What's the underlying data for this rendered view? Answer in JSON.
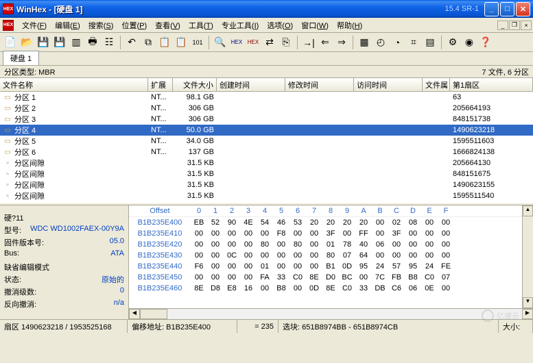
{
  "window": {
    "title": "WinHex - [硬盘 1]",
    "version": "15.4 SR-1"
  },
  "menus": [
    {
      "label": "文件",
      "hot": "F"
    },
    {
      "label": "编辑",
      "hot": "E"
    },
    {
      "label": "搜索",
      "hot": "S"
    },
    {
      "label": "位置",
      "hot": "P"
    },
    {
      "label": "查看",
      "hot": "V"
    },
    {
      "label": "工具",
      "hot": "T"
    },
    {
      "label": "专业工具",
      "hot": "I"
    },
    {
      "label": "选项",
      "hot": "O"
    },
    {
      "label": "窗口",
      "hot": "W"
    },
    {
      "label": "帮助",
      "hot": "H"
    }
  ],
  "tab": "硬盘 1",
  "info_left": "分区类型: MBR",
  "info_right": "7 文件, 6 分区",
  "columns": {
    "name": "文件名称",
    "ext": "扩展",
    "size": "文件大小",
    "ctime": "创建时间",
    "mtime": "修改时间",
    "atime": "访问时间",
    "attr": "文件属",
    "sect": "第1扇区"
  },
  "files": [
    {
      "icon": "part",
      "name": "分区 1",
      "ext": "NT...",
      "size": "98.1 GB",
      "sect": "63"
    },
    {
      "icon": "part",
      "name": "分区 2",
      "ext": "NT...",
      "size": "306 GB",
      "sect": "205664193"
    },
    {
      "icon": "part",
      "name": "分区 3",
      "ext": "NT...",
      "size": "306 GB",
      "sect": "848151738"
    },
    {
      "icon": "part",
      "name": "分区 4",
      "ext": "NT...",
      "size": "50.0 GB",
      "sect": "1490623218",
      "sel": true
    },
    {
      "icon": "part",
      "name": "分区 5",
      "ext": "NT...",
      "size": "34.0 GB",
      "sect": "1595511603"
    },
    {
      "icon": "part",
      "name": "分区 6",
      "ext": "NT...",
      "size": "137 GB",
      "sect": "1666824138"
    },
    {
      "icon": "gap",
      "name": "分区间隙",
      "ext": "",
      "size": "31.5 KB",
      "sect": "205664130"
    },
    {
      "icon": "gap",
      "name": "分区间隙",
      "ext": "",
      "size": "31.5 KB",
      "sect": "848151675"
    },
    {
      "icon": "gap",
      "name": "分区间隙",
      "ext": "",
      "size": "31.5 KB",
      "sect": "1490623155"
    },
    {
      "icon": "gap",
      "name": "分区间隙",
      "ext": "",
      "size": "31.5 KB",
      "sect": "1595511540"
    }
  ],
  "panel": {
    "title": "硬?11",
    "model_lbl": "型号:",
    "model": "WDC WD1002FAEX-00Y9A",
    "fw_lbl": "固件版本号:",
    "fw": "05.0",
    "bus_lbl": "Bus:",
    "bus": "ATA",
    "editmode": "缺省编辑模式",
    "state_lbl": "状态:",
    "state": "原始的",
    "undo_lbl": "撤消级数:",
    "undo": "0",
    "rev_lbl": "反向撤消:",
    "rev": "n/a"
  },
  "hex": {
    "offset_lbl": "Offset",
    "cols": [
      "0",
      "1",
      "2",
      "3",
      "4",
      "5",
      "6",
      "7",
      "8",
      "9",
      "A",
      "B",
      "C",
      "D",
      "E",
      "F"
    ],
    "rows": [
      {
        "o": "B1B235E400",
        "b": [
          "EB",
          "52",
          "90",
          "4E",
          "54",
          "46",
          "53",
          "20",
          "20",
          "20",
          "20",
          "00",
          "02",
          "08",
          "00",
          "00"
        ]
      },
      {
        "o": "B1B235E410",
        "b": [
          "00",
          "00",
          "00",
          "00",
          "00",
          "F8",
          "00",
          "00",
          "3F",
          "00",
          "FF",
          "00",
          "3F",
          "00",
          "00",
          "00"
        ]
      },
      {
        "o": "B1B235E420",
        "b": [
          "00",
          "00",
          "00",
          "00",
          "80",
          "00",
          "80",
          "00",
          "01",
          "78",
          "40",
          "06",
          "00",
          "00",
          "00",
          "00"
        ]
      },
      {
        "o": "B1B235E430",
        "b": [
          "00",
          "00",
          "0C",
          "00",
          "00",
          "00",
          "00",
          "00",
          "80",
          "07",
          "64",
          "00",
          "00",
          "00",
          "00",
          "00"
        ]
      },
      {
        "o": "B1B235E440",
        "b": [
          "F6",
          "00",
          "00",
          "00",
          "01",
          "00",
          "00",
          "00",
          "B1",
          "0D",
          "95",
          "24",
          "57",
          "95",
          "24",
          "FE"
        ]
      },
      {
        "o": "B1B235E450",
        "b": [
          "00",
          "00",
          "00",
          "00",
          "FA",
          "33",
          "C0",
          "8E",
          "D0",
          "BC",
          "00",
          "7C",
          "FB",
          "B8",
          "C0",
          "07"
        ]
      },
      {
        "o": "B1B235E460",
        "b": [
          "8E",
          "D8",
          "E8",
          "16",
          "00",
          "B8",
          "00",
          "0D",
          "8E",
          "C0",
          "33",
          "DB",
          "C6",
          "06",
          "0E",
          "00"
        ]
      }
    ]
  },
  "status": {
    "sector": "扇区 1490623218 / 1953525168",
    "addr": "偏移地址: B1B235E400",
    "val": "= 235",
    "sel": "选块: 651B8974BB - 651B8974CB",
    "size": "大小:"
  },
  "watermark": "亿速云"
}
